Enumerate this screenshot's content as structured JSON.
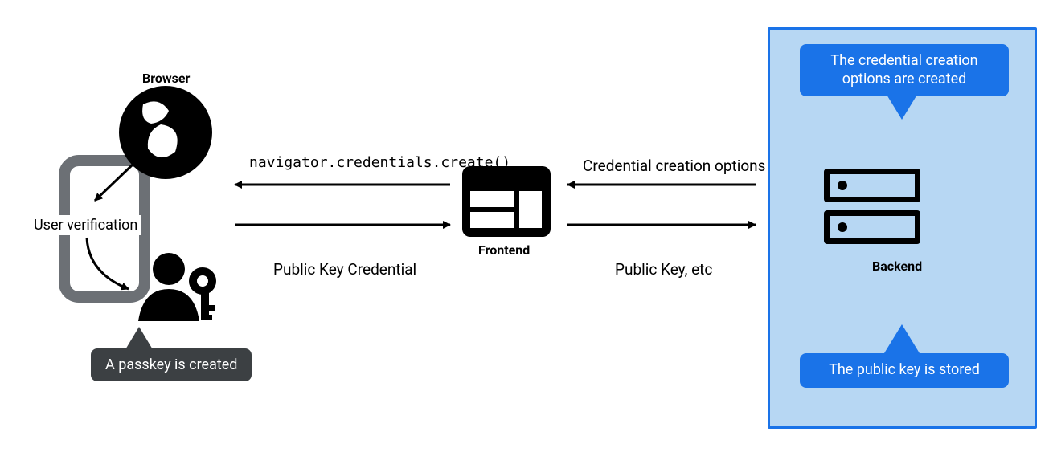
{
  "browser": {
    "label": "Browser"
  },
  "frontend": {
    "label": "Frontend"
  },
  "backend": {
    "label": "Backend"
  },
  "user_verification_label": "User verification",
  "callouts": {
    "options_created": "The credential creation options are created",
    "passkey_created": "A passkey is created",
    "pubkey_stored": "The public key is stored"
  },
  "flows": {
    "api_call": "navigator.credentials.create()",
    "public_key_credential": "Public Key Credential",
    "credential_creation_options": "Credential creation options",
    "public_key_etc": "Public Key, etc"
  }
}
